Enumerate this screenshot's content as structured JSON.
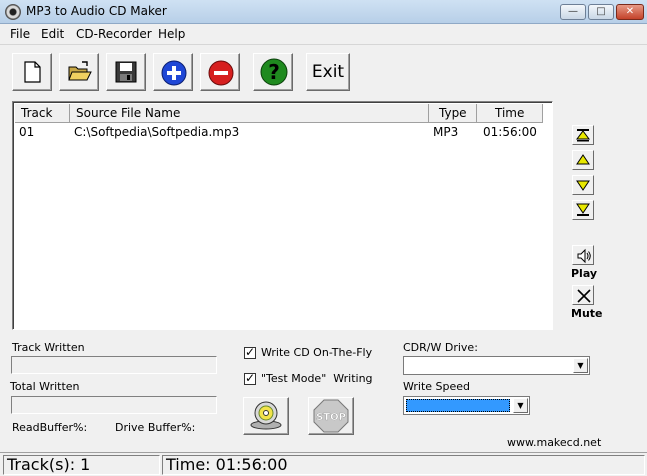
{
  "window": {
    "title": "MP3 to Audio CD Maker",
    "min_glyph": "—",
    "max_glyph": "□",
    "close_glyph": "✕"
  },
  "menu": [
    "File",
    "Edit",
    "CD-Recorder",
    "Help"
  ],
  "toolbar": {
    "exit_label": "Exit"
  },
  "tracklist": {
    "columns": [
      "Track",
      "Source File Name",
      "Type",
      "Time"
    ],
    "rows": [
      {
        "track": "01",
        "source": "C:\\Softpedia\\Softpedia.mp3",
        "type": "MP3",
        "time": "01:56:00"
      }
    ]
  },
  "side": {
    "play_label": "Play",
    "mute_label": "Mute"
  },
  "progress": {
    "track_written_label": "Track Written",
    "total_written_label": "Total Written",
    "read_buffer_label": "ReadBuffer%:",
    "drive_buffer_label": "Drive Buffer%:"
  },
  "options": {
    "write_on_the_fly_label": "Write CD On-The-Fly",
    "write_on_the_fly_checked": true,
    "test_mode_label": "\"Test Mode\"  Writing",
    "test_mode_checked": true
  },
  "drive": {
    "drive_label": "CDR/W Drive:",
    "drive_value": "",
    "speed_label": "Write Speed",
    "speed_value": ""
  },
  "website": "www.makecd.net",
  "status": {
    "tracks": "Track(s): 1",
    "time": "Time: 01:56:00"
  },
  "colors": {
    "selection": "#3399ff",
    "add": "#1f47d6",
    "remove": "#d61f1f",
    "help": "#1f8a1f",
    "arrows": "#e8e800"
  }
}
